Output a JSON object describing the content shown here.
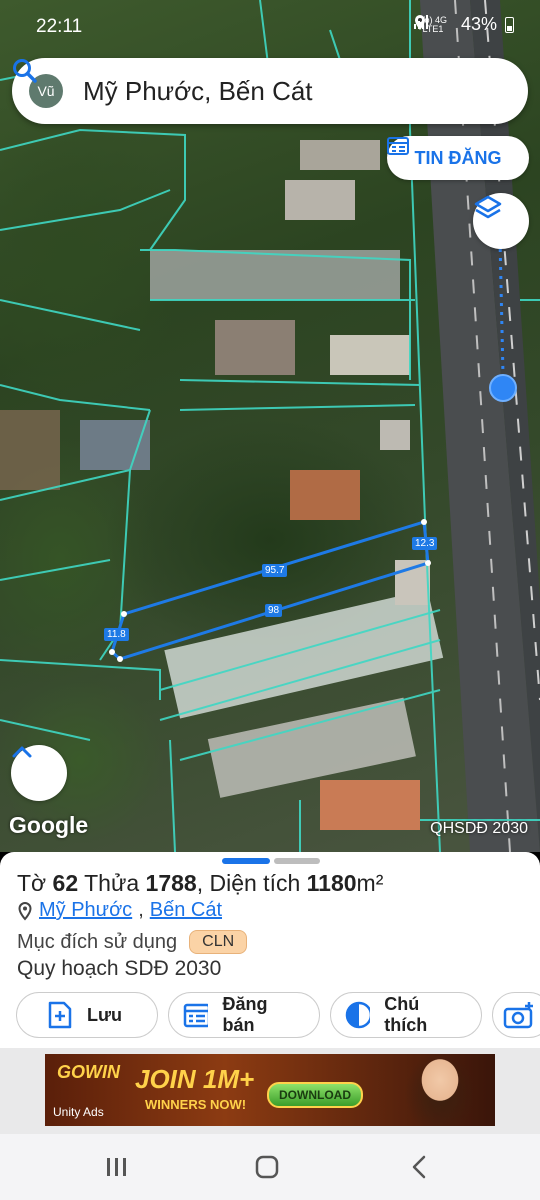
{
  "status_bar": {
    "time": "22:11",
    "network": "Vo) 4G LTE1",
    "battery": "43%"
  },
  "search": {
    "avatar_initials": "Vũ",
    "query": "Mỹ Phước, Bến Cát"
  },
  "map": {
    "post_button_label": "TIN ĐĂNG",
    "attribution": "Google",
    "overlay_label": "QHSDĐ 2030",
    "measurements": [
      "95.7",
      "12.3",
      "98",
      "11.8"
    ]
  },
  "parcel": {
    "sheet_label": "Tờ",
    "sheet_number": "62",
    "lot_label": "Thửa",
    "lot_number": "1788",
    "area_label": ", Diện tích",
    "area_value": "1180",
    "area_unit": "m²",
    "ward": "Mỹ Phước",
    "district": "Bến Cát",
    "purpose_label": "Mục đích sử dụng",
    "purpose_code": "CLN",
    "plan_label": "Quy hoạch SDĐ 2030"
  },
  "actions": [
    {
      "label": "Lưu",
      "icon": "save-plus-icon"
    },
    {
      "label": "Đăng bán",
      "icon": "calendar-list-icon"
    },
    {
      "label": "Chú thích",
      "icon": "half-circle-icon"
    },
    {
      "label": "",
      "icon": "camera-add-icon"
    }
  ],
  "ad": {
    "brand": "GOWIN",
    "headline": "JOIN 1M+",
    "subline": "WINNERS NOW!",
    "cta": "DOWNLOAD",
    "network": "Unity Ads"
  },
  "colors": {
    "accent": "#1a73e8",
    "parcel_lines": "#3fd8c4",
    "measure_line": "#1e7ae6",
    "badge": "#fbd3a6"
  }
}
